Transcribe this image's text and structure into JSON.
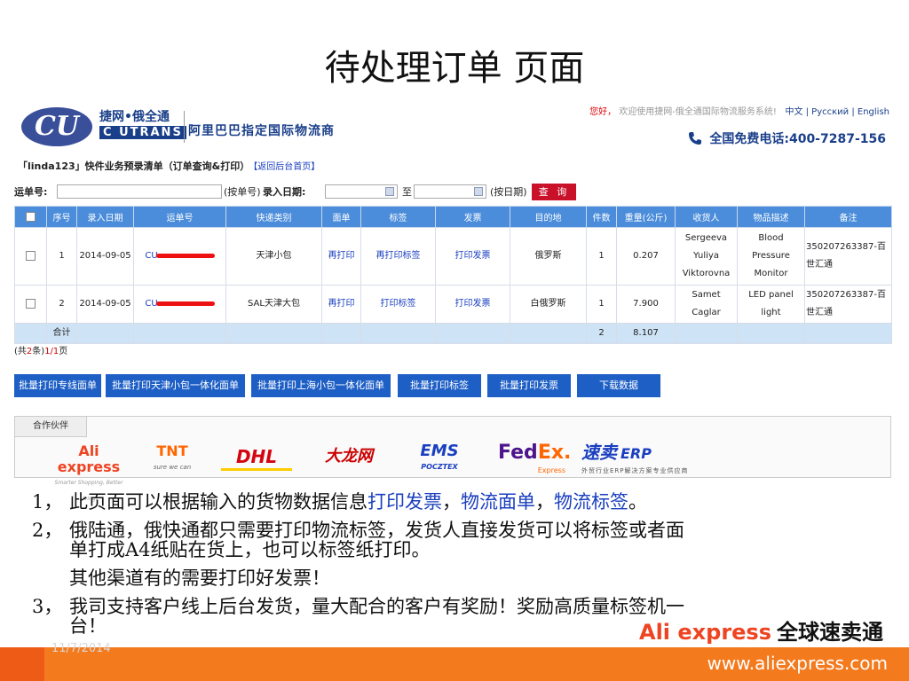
{
  "slide": {
    "title": "待处理订单 页面"
  },
  "header": {
    "logo_text": "CU",
    "brand_cn": "捷网•俄全通",
    "brand_en": "C UTRANS",
    "tagline": "阿里巴巴指定国际物流商",
    "welcome_hi": "您好，",
    "welcome_msg": "欢迎使用捷网-俄全通国际物流服务系统!",
    "lang_links": "中文 | Русский | English",
    "hotline": "全国免费电话:400-7287-156"
  },
  "page": {
    "heading": "「linda123」快件业务预录清单（订单查询&打印）",
    "back_link": "【返回后台首页】"
  },
  "search": {
    "waybill_label": "运单号:",
    "by_waybill": "(按单号)",
    "entry_date_label": "录入日期:",
    "to": "至",
    "by_date": "(按日期)",
    "query_button": "查 询"
  },
  "table": {
    "columns": [
      "序号",
      "录入日期",
      "运单号",
      "快递类别",
      "面单",
      "标签",
      "发票",
      "目的地",
      "件数",
      "重量(公斤)",
      "收货人",
      "物品描述",
      "备注"
    ],
    "rows": [
      {
        "no": "1",
        "date": "2014-09-05",
        "waybill": "CU",
        "type": "天津小包",
        "sheet": "再打印",
        "label": "再打印标签",
        "invoice": "打印发票",
        "dest": "俄罗斯",
        "qty": "1",
        "weight": "0.207",
        "receiver_l1": "Sergeeva",
        "receiver_l2": "Yuliya",
        "receiver_l3": "Viktorovna",
        "desc_l1": "Blood Pressure",
        "desc_l2": "Monitor",
        "note_l1": "350207263387-百",
        "note_l2": "世汇通"
      },
      {
        "no": "2",
        "date": "2014-09-05",
        "waybill": "CU",
        "type": "SAL天津大包",
        "sheet": "再打印",
        "label": "打印标签",
        "invoice": "打印发票",
        "dest": "白俄罗斯",
        "qty": "1",
        "weight": "7.900",
        "receiver_l1": "Samet Caglar",
        "desc_l1": "LED panel light",
        "note_l1": "350207263387-百",
        "note_l2": "世汇通"
      }
    ],
    "total": {
      "label": "合计",
      "qty": "2",
      "weight": "8.107"
    }
  },
  "pager": {
    "prefix": "(共",
    "count": "2",
    "mid": "条)",
    "page": "1/1",
    "suffix": "页"
  },
  "actions": [
    "批量打印专线面单",
    "批量打印天津小包一体化面单",
    "批量打印上海小包一体化面单",
    "批量打印标签",
    "批量打印发票",
    "下载数据"
  ],
  "partners": {
    "tab_label": "合作伙伴",
    "aliexpress": "Ali express",
    "aliexpress_sub": "Smarter Shopping, Better Living!",
    "tnt": "TNT",
    "tnt_sub": "sure we can",
    "dhl": "DHL",
    "dalong": "大龙网",
    "ems": "EMS",
    "ems_sub": "POCZTEX",
    "fedex_fed": "Fed",
    "fedex_ex": "Ex.",
    "fedex_sub": "Express",
    "sumai": "速卖",
    "sumai_erp": "ERP",
    "sumai_sub": "外贸行业ERP解决方案专业供应商"
  },
  "notes": {
    "n1_num": "1，",
    "n1_a": "此页面可以根据输入的货物数据信息",
    "n1_h1": "打印发票",
    "n1_s1": "，",
    "n1_h2": "物流面单",
    "n1_s2": "，",
    "n1_h3": "物流标签",
    "n1_end": "。",
    "n2_num": "2，",
    "n2_l1": "俄陆通，俄快通都只需要打印物流标签，发货人直接发货可以将标签或者面",
    "n2_l2": "单打成A4纸贴在货上，也可以标签纸打印。",
    "n2_l3": "其他渠道有的需要打印好发票！",
    "n3_num": "3，",
    "n3_l1": "我司支持客户线上后台发货，量大配合的客户有奖励！奖励高质量标签机一",
    "n3_l2": "台！"
  },
  "footer": {
    "banner_en": "Ali express",
    "banner_cn": "全球速卖通",
    "date": "11/7/2014",
    "url": "www.aliexpress.com"
  },
  "colors": {
    "accent_blue": "#1e5fc6",
    "header_blue": "#4b8dda",
    "query_red": "#c9112a",
    "footer_orange": "#f47a1e"
  }
}
